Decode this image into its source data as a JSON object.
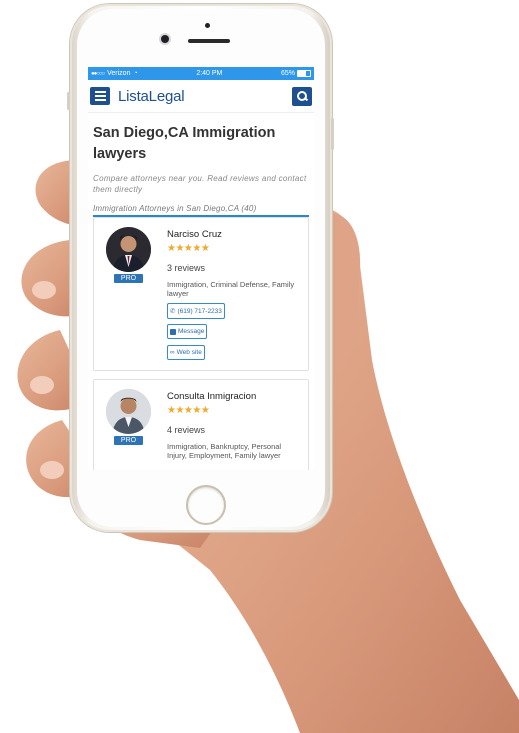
{
  "status_bar": {
    "signal_dots": "●●○○○",
    "carrier": "Verizon",
    "wifi_icon": "wifi-icon",
    "time": "2:40 PM",
    "battery": "65%"
  },
  "nav": {
    "brand": "ListaLegal",
    "menu_icon": "hamburger-menu-icon",
    "search_icon": "search-icon",
    "accent_color": "#1d4f91"
  },
  "page": {
    "title": "San Diego,CA Immigration lawyers",
    "subtitle": "Compare attorneys near you. Read reviews and contact them directly",
    "results_line": "Immigration Attorneys in San Diego,CA (40)"
  },
  "lawyers": [
    {
      "name": "Narciso Cruz",
      "badge": "PRO",
      "stars": "★★★★★",
      "reviews": "3 reviews",
      "practice_areas": "Immigration, Criminal Defense, Family lawyer",
      "phone": "(619) 717-2233",
      "message_label": "Message",
      "website_label": "Web site"
    },
    {
      "name": "Consulta Inmigracion",
      "badge": "PRO",
      "stars": "★★★★★",
      "reviews": "4 reviews",
      "practice_areas": "Immigration, Bankruptcy, Personal Injury, Employment, Family lawyer"
    }
  ],
  "colors": {
    "status_bar": "#2f97ea",
    "star": "#f0a92b",
    "pro_badge": "#2e74b5",
    "rule": "#2a86c9"
  }
}
